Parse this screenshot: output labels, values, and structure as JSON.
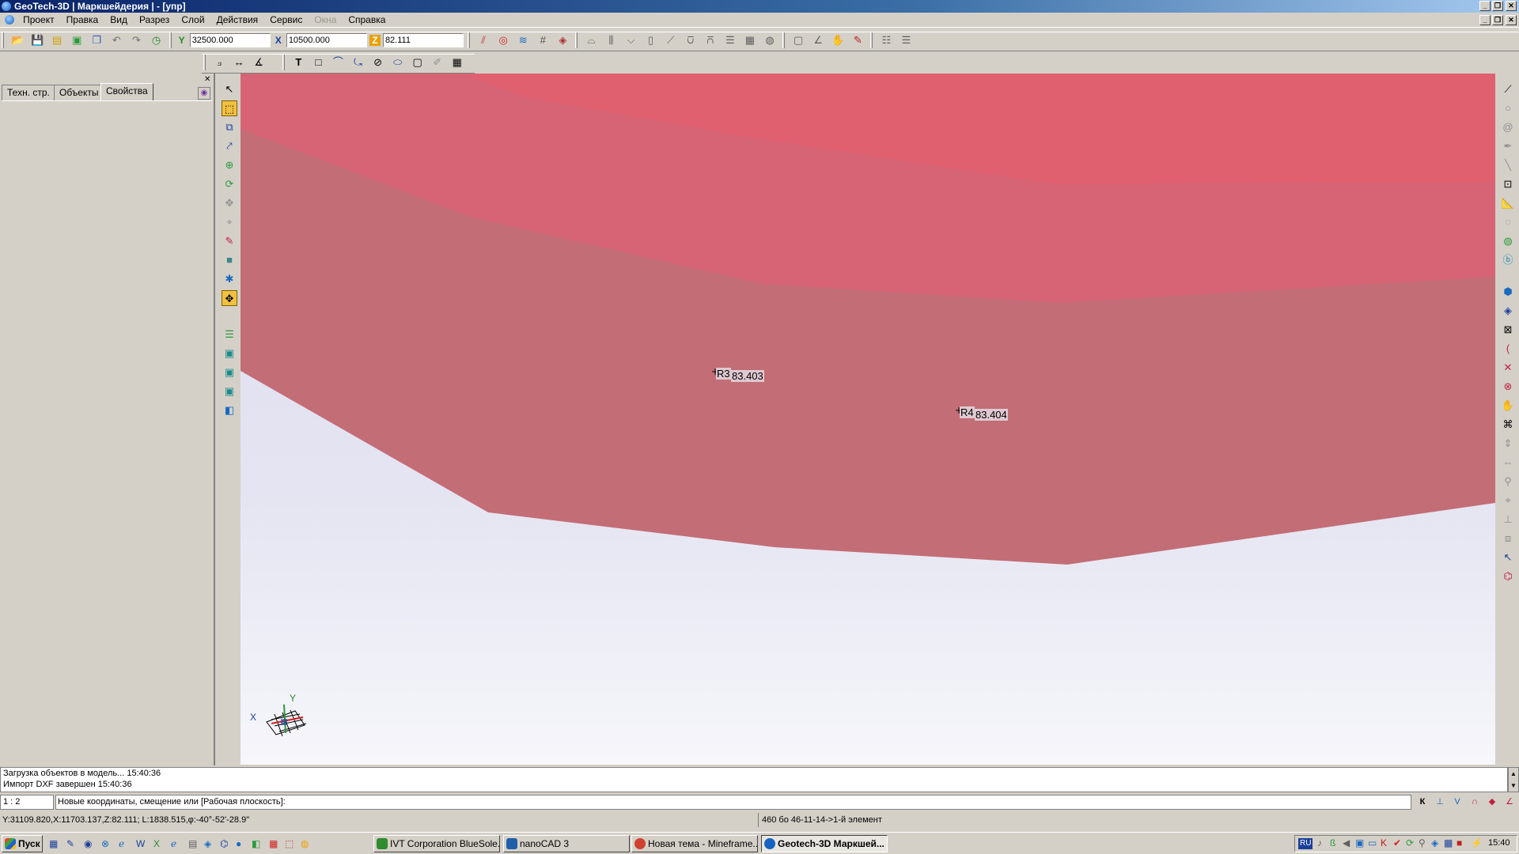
{
  "window": {
    "title": "GeoTech-3D | Маркшейдерия | - [упр]",
    "controls": [
      "_",
      "❐",
      "✕"
    ]
  },
  "menu": {
    "items": [
      "Проект",
      "Правка",
      "Вид",
      "Разрез",
      "Слой",
      "Действия",
      "Сервис",
      "Окна",
      "Справка"
    ],
    "disabled": "Окна"
  },
  "toolbar": {
    "y_label": "Y",
    "y_value": "32500.000",
    "x_label": "X",
    "x_value": "10500.000",
    "z_label": "Z",
    "z_value": "82.111"
  },
  "left_panel": {
    "tabs": [
      "Техн. стр.",
      "Объекты",
      "Свойства"
    ],
    "active_tab": "Свойства"
  },
  "viewport": {
    "points": [
      {
        "name": "R3",
        "value": "83.403"
      },
      {
        "name": "R4",
        "value": "83.404"
      }
    ],
    "axis_labels": {
      "x": "X",
      "y": "Y"
    },
    "colors": {
      "surface_top": "#e06070",
      "surface_mid": "#d66474",
      "surface_low": "#c36d76",
      "background": "#e4e4f2"
    }
  },
  "command_log": {
    "lines": [
      "Загрузка объектов в модель... 15:40:36",
      "Импорт DXF завершен 15:40:36"
    ]
  },
  "command_line": {
    "scale": "1 : 2",
    "prompt": "Новые координаты, смещение или [Рабочая плоскость]:",
    "snap_buttons": [
      "К",
      "⊥",
      "V",
      "∩",
      "◆",
      "∠"
    ]
  },
  "status_bar": {
    "coords": "Y:31109.820,X:11703.137,Z:82.111; L:1838.515,φ:-40°-52'-28.9\"",
    "selection": "460 бо 46-11-14->1-й элемент"
  },
  "taskbar": {
    "start": "Пуск",
    "tasks": [
      {
        "label": "IVT Corporation BlueSole...",
        "active": false,
        "color": "#2e8b2e"
      },
      {
        "label": "nanoCAD 3",
        "active": false,
        "color": "#1f5fa8"
      },
      {
        "label": "Новая тема - Mineframe...",
        "active": false,
        "color": "#d04030"
      },
      {
        "label": "Geotech-3D Маркшей...",
        "active": true,
        "color": "#1565c0"
      }
    ],
    "lang": "RU",
    "clock": "15:40"
  }
}
